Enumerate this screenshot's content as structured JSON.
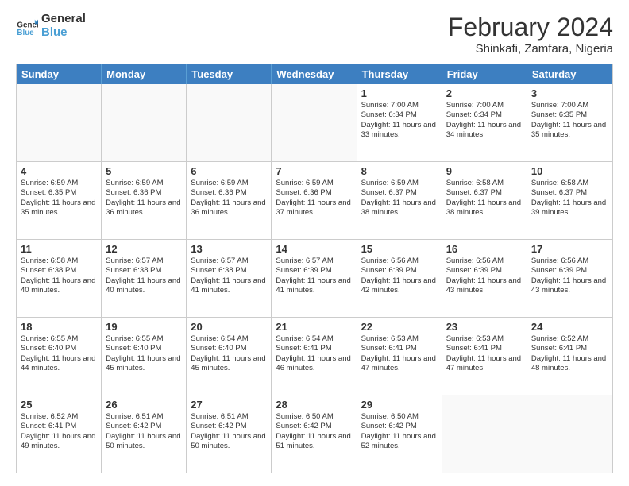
{
  "header": {
    "logo_general": "General",
    "logo_blue": "Blue",
    "month_year": "February 2024",
    "location": "Shinkafi, Zamfara, Nigeria"
  },
  "days_of_week": [
    "Sunday",
    "Monday",
    "Tuesday",
    "Wednesday",
    "Thursday",
    "Friday",
    "Saturday"
  ],
  "weeks": [
    [
      {
        "day": "",
        "sunrise": "",
        "sunset": "",
        "daylight": ""
      },
      {
        "day": "",
        "sunrise": "",
        "sunset": "",
        "daylight": ""
      },
      {
        "day": "",
        "sunrise": "",
        "sunset": "",
        "daylight": ""
      },
      {
        "day": "",
        "sunrise": "",
        "sunset": "",
        "daylight": ""
      },
      {
        "day": "1",
        "sunrise": "Sunrise: 7:00 AM",
        "sunset": "Sunset: 6:34 PM",
        "daylight": "Daylight: 11 hours and 33 minutes."
      },
      {
        "day": "2",
        "sunrise": "Sunrise: 7:00 AM",
        "sunset": "Sunset: 6:34 PM",
        "daylight": "Daylight: 11 hours and 34 minutes."
      },
      {
        "day": "3",
        "sunrise": "Sunrise: 7:00 AM",
        "sunset": "Sunset: 6:35 PM",
        "daylight": "Daylight: 11 hours and 35 minutes."
      }
    ],
    [
      {
        "day": "4",
        "sunrise": "Sunrise: 6:59 AM",
        "sunset": "Sunset: 6:35 PM",
        "daylight": "Daylight: 11 hours and 35 minutes."
      },
      {
        "day": "5",
        "sunrise": "Sunrise: 6:59 AM",
        "sunset": "Sunset: 6:36 PM",
        "daylight": "Daylight: 11 hours and 36 minutes."
      },
      {
        "day": "6",
        "sunrise": "Sunrise: 6:59 AM",
        "sunset": "Sunset: 6:36 PM",
        "daylight": "Daylight: 11 hours and 36 minutes."
      },
      {
        "day": "7",
        "sunrise": "Sunrise: 6:59 AM",
        "sunset": "Sunset: 6:36 PM",
        "daylight": "Daylight: 11 hours and 37 minutes."
      },
      {
        "day": "8",
        "sunrise": "Sunrise: 6:59 AM",
        "sunset": "Sunset: 6:37 PM",
        "daylight": "Daylight: 11 hours and 38 minutes."
      },
      {
        "day": "9",
        "sunrise": "Sunrise: 6:58 AM",
        "sunset": "Sunset: 6:37 PM",
        "daylight": "Daylight: 11 hours and 38 minutes."
      },
      {
        "day": "10",
        "sunrise": "Sunrise: 6:58 AM",
        "sunset": "Sunset: 6:37 PM",
        "daylight": "Daylight: 11 hours and 39 minutes."
      }
    ],
    [
      {
        "day": "11",
        "sunrise": "Sunrise: 6:58 AM",
        "sunset": "Sunset: 6:38 PM",
        "daylight": "Daylight: 11 hours and 40 minutes."
      },
      {
        "day": "12",
        "sunrise": "Sunrise: 6:57 AM",
        "sunset": "Sunset: 6:38 PM",
        "daylight": "Daylight: 11 hours and 40 minutes."
      },
      {
        "day": "13",
        "sunrise": "Sunrise: 6:57 AM",
        "sunset": "Sunset: 6:38 PM",
        "daylight": "Daylight: 11 hours and 41 minutes."
      },
      {
        "day": "14",
        "sunrise": "Sunrise: 6:57 AM",
        "sunset": "Sunset: 6:39 PM",
        "daylight": "Daylight: 11 hours and 41 minutes."
      },
      {
        "day": "15",
        "sunrise": "Sunrise: 6:56 AM",
        "sunset": "Sunset: 6:39 PM",
        "daylight": "Daylight: 11 hours and 42 minutes."
      },
      {
        "day": "16",
        "sunrise": "Sunrise: 6:56 AM",
        "sunset": "Sunset: 6:39 PM",
        "daylight": "Daylight: 11 hours and 43 minutes."
      },
      {
        "day": "17",
        "sunrise": "Sunrise: 6:56 AM",
        "sunset": "Sunset: 6:39 PM",
        "daylight": "Daylight: 11 hours and 43 minutes."
      }
    ],
    [
      {
        "day": "18",
        "sunrise": "Sunrise: 6:55 AM",
        "sunset": "Sunset: 6:40 PM",
        "daylight": "Daylight: 11 hours and 44 minutes."
      },
      {
        "day": "19",
        "sunrise": "Sunrise: 6:55 AM",
        "sunset": "Sunset: 6:40 PM",
        "daylight": "Daylight: 11 hours and 45 minutes."
      },
      {
        "day": "20",
        "sunrise": "Sunrise: 6:54 AM",
        "sunset": "Sunset: 6:40 PM",
        "daylight": "Daylight: 11 hours and 45 minutes."
      },
      {
        "day": "21",
        "sunrise": "Sunrise: 6:54 AM",
        "sunset": "Sunset: 6:41 PM",
        "daylight": "Daylight: 11 hours and 46 minutes."
      },
      {
        "day": "22",
        "sunrise": "Sunrise: 6:53 AM",
        "sunset": "Sunset: 6:41 PM",
        "daylight": "Daylight: 11 hours and 47 minutes."
      },
      {
        "day": "23",
        "sunrise": "Sunrise: 6:53 AM",
        "sunset": "Sunset: 6:41 PM",
        "daylight": "Daylight: 11 hours and 47 minutes."
      },
      {
        "day": "24",
        "sunrise": "Sunrise: 6:52 AM",
        "sunset": "Sunset: 6:41 PM",
        "daylight": "Daylight: 11 hours and 48 minutes."
      }
    ],
    [
      {
        "day": "25",
        "sunrise": "Sunrise: 6:52 AM",
        "sunset": "Sunset: 6:41 PM",
        "daylight": "Daylight: 11 hours and 49 minutes."
      },
      {
        "day": "26",
        "sunrise": "Sunrise: 6:51 AM",
        "sunset": "Sunset: 6:42 PM",
        "daylight": "Daylight: 11 hours and 50 minutes."
      },
      {
        "day": "27",
        "sunrise": "Sunrise: 6:51 AM",
        "sunset": "Sunset: 6:42 PM",
        "daylight": "Daylight: 11 hours and 50 minutes."
      },
      {
        "day": "28",
        "sunrise": "Sunrise: 6:50 AM",
        "sunset": "Sunset: 6:42 PM",
        "daylight": "Daylight: 11 hours and 51 minutes."
      },
      {
        "day": "29",
        "sunrise": "Sunrise: 6:50 AM",
        "sunset": "Sunset: 6:42 PM",
        "daylight": "Daylight: 11 hours and 52 minutes."
      },
      {
        "day": "",
        "sunrise": "",
        "sunset": "",
        "daylight": ""
      },
      {
        "day": "",
        "sunrise": "",
        "sunset": "",
        "daylight": ""
      }
    ]
  ]
}
